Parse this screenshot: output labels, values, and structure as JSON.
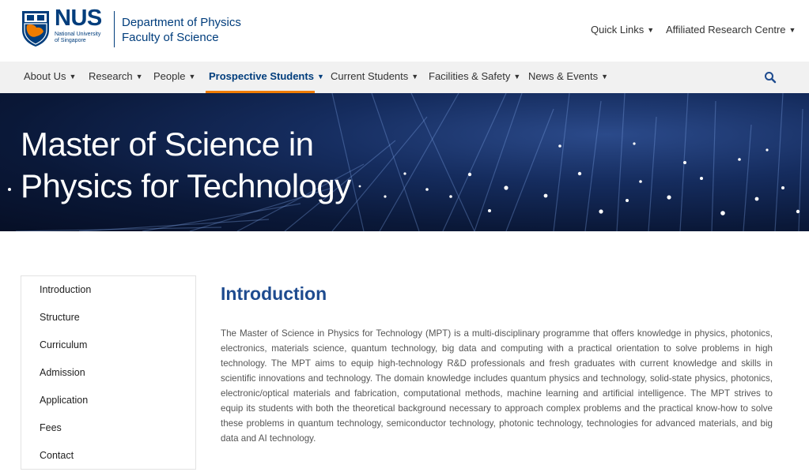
{
  "header": {
    "crest_name": "nus-crest-icon",
    "wordmark": "NUS",
    "university_lines": [
      "National University",
      "of Singapore"
    ],
    "department": "Department of Physics",
    "faculty": "Faculty of Science",
    "utility_links": [
      {
        "label": "Quick Links"
      },
      {
        "label": "Affiliated Research Centre"
      }
    ]
  },
  "nav": {
    "items": [
      {
        "label": "About Us"
      },
      {
        "label": "Research"
      },
      {
        "label": "People"
      },
      {
        "label": "Prospective Students",
        "active": true
      },
      {
        "label": "Current Students"
      },
      {
        "label": "Facilities & Safety"
      },
      {
        "label": "News & Events"
      }
    ],
    "search_icon": "search-icon"
  },
  "hero": {
    "title_line1": "Master of Science in",
    "title_line2": "Physics for Technology"
  },
  "sidebar": {
    "items": [
      {
        "label": "Introduction"
      },
      {
        "label": "Structure"
      },
      {
        "label": "Curriculum"
      },
      {
        "label": "Admission"
      },
      {
        "label": "Application"
      },
      {
        "label": "Fees"
      },
      {
        "label": "Contact"
      }
    ]
  },
  "content": {
    "heading": "Introduction",
    "body": "The Master of Science in Physics for Technology (MPT) is a multi-disciplinary programme that offers knowledge in physics, photonics, electronics, materials science, quantum technology, big data and computing with a practical orientation to solve problems in high technology. The MPT aims to equip high-technology R&D professionals and fresh graduates with current knowledge and skills in scientific innovations and technology. The domain knowledge includes quantum physics and technology, solid-state physics, photonics, electronic/optical materials and fabrication, computational methods, machine learning and artificial intelligence. The MPT strives to equip its students with both the theoretical background necessary to approach complex problems and the practical know-how to solve these problems in quantum technology, semiconductor technology, photonic technology, technologies for advanced materials, and big data and AI technology."
  },
  "colors": {
    "brand_blue": "#003d7c",
    "brand_orange": "#ef7c00",
    "heading_blue": "#1e4b8f"
  }
}
